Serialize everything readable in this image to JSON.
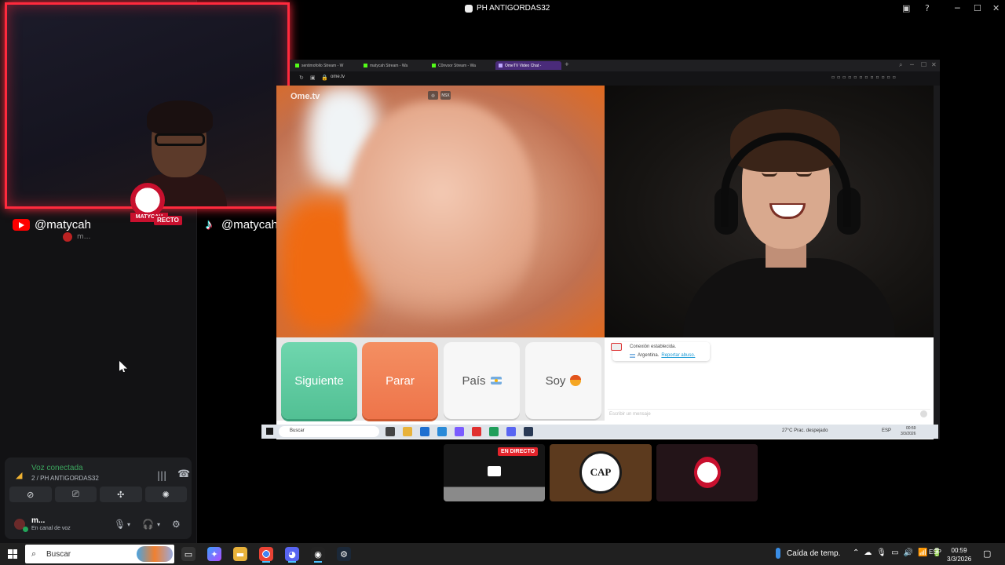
{
  "window_title": "PH ANTIGORDAS32",
  "overlay": {
    "live_label": "RECTO",
    "logo_text": "MATYCAH",
    "youtube_handle": "@matycah",
    "tiktok_handle": "@matycah",
    "sub_user": "m..."
  },
  "voice": {
    "status": "Voz conectada",
    "channel": "2 / PH ANTIGORDAS32",
    "user_name": "m...",
    "user_status": "En canal de voz"
  },
  "browser": {
    "tabs": [
      {
        "label": "sentimofollo Stream - W"
      },
      {
        "label": "matycah Stream - Wa"
      },
      {
        "label": "C0nvxor Stream - Wa"
      },
      {
        "label": "OmeTV Video Chat -"
      }
    ],
    "url": "ome.tv"
  },
  "ometv": {
    "logo": "Ome.tv",
    "video_ctrl_2": "NSX",
    "buttons": {
      "next": "Siguiente",
      "stop": "Parar",
      "country": "País",
      "gender": "Soy"
    },
    "chat": {
      "connected": "Conexión establecida.",
      "country": "Argentina.",
      "report": "Reportar abuso.",
      "input_placeholder": "Escribir un mensaje"
    }
  },
  "inner_taskbar": {
    "search": "Buscar",
    "weather": "27°C  Prac. despejado",
    "lang": "ESP",
    "time": "00:59",
    "date": "3/3/2026"
  },
  "tiles": {
    "live_badge": "EN DIRECTO",
    "cap_text": "CAP"
  },
  "taskbar": {
    "search": "Buscar",
    "weather": "Caída de temp.",
    "lang": "ESP",
    "time": "00:59",
    "date": "3/3/2026"
  },
  "colors": {
    "overlay_border": "#ff2a3d",
    "next_button": "#5cc99f",
    "stop_button": "#f07f53",
    "voice_connected": "#3ba55d"
  }
}
